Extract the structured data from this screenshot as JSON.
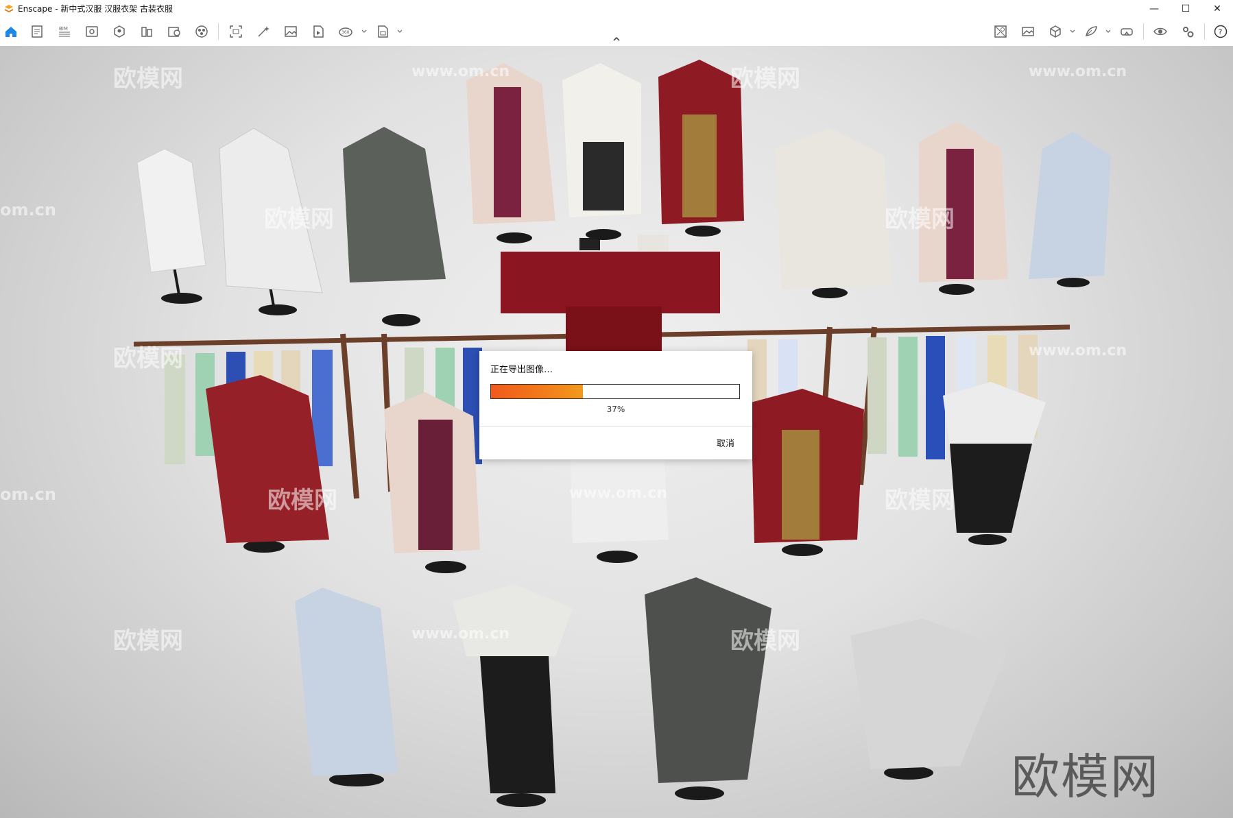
{
  "window": {
    "title": "Enscape - 新中式汉服 汉服衣架 古装衣服",
    "minimize": "—",
    "maximize": "☐",
    "close": "✕"
  },
  "toolbar": {
    "left": [
      {
        "name": "home-icon",
        "active": true
      },
      {
        "name": "screenshot-log-icon"
      },
      {
        "name": "bim-icon",
        "label": "BIM"
      },
      {
        "name": "view-management-icon"
      },
      {
        "name": "atmosphere-icon"
      },
      {
        "name": "sections-icon"
      },
      {
        "name": "material-editor-icon"
      },
      {
        "name": "asset-library-icon"
      },
      {
        "name": "capture-icon"
      },
      {
        "name": "render-magic-icon"
      },
      {
        "name": "image-icon"
      },
      {
        "name": "video-editor-icon"
      },
      {
        "name": "panorama-360-icon",
        "label": "360"
      },
      {
        "name": "export-icon"
      }
    ],
    "right": [
      {
        "name": "uploads-icon"
      },
      {
        "name": "gallery-icon"
      },
      {
        "name": "3d-cube-icon"
      },
      {
        "name": "feedback-icon"
      },
      {
        "name": "vr-headset-icon"
      },
      {
        "name": "visibility-icon"
      },
      {
        "name": "settings-icon"
      },
      {
        "name": "help-icon"
      }
    ]
  },
  "watermarks": {
    "cn": "欧模网",
    "url": "www.om.cn",
    "url_short": "om.cn",
    "big": "欧模网"
  },
  "dialog": {
    "title": "正在导出图像…",
    "progress": 0.37,
    "progress_label": "37%",
    "cancel_label": "取消"
  }
}
